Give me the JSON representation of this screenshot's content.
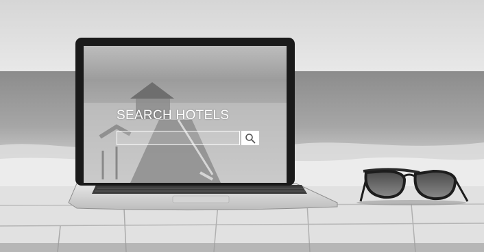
{
  "search": {
    "title": "SEARCH HOTELS",
    "input_value": "",
    "placeholder": "",
    "button_icon": "magnifier-icon"
  },
  "colors": {
    "image_tone": "grayscale",
    "search_text": "#ffffff"
  }
}
